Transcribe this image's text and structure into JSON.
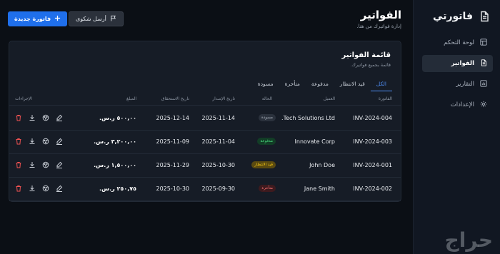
{
  "app": {
    "name": "فاتورتي"
  },
  "sidebar": {
    "items": [
      {
        "label": "لوحة التحكم",
        "icon": "layout-icon",
        "active": false
      },
      {
        "label": "الفواتير",
        "icon": "file-icon",
        "active": true
      },
      {
        "label": "التقارير",
        "icon": "chart-icon",
        "active": false
      },
      {
        "label": "الإعدادات",
        "icon": "gear-icon",
        "active": false
      }
    ]
  },
  "header": {
    "title": "الفواتير",
    "subtitle": "إدارة فواتيرك من هنا.",
    "feedback_label": "أرسل شكوى",
    "new_invoice_label": "فاتورة جديدة"
  },
  "card": {
    "title": "قائمة الفواتير",
    "subtitle": "قائمة بجميع فواتيرك."
  },
  "tabs": [
    {
      "label": "الكل",
      "active": true
    },
    {
      "label": "قيد الانتظار",
      "active": false
    },
    {
      "label": "مدفوعة",
      "active": false
    },
    {
      "label": "متأخرة",
      "active": false
    },
    {
      "label": "مسودة",
      "active": false
    }
  ],
  "table": {
    "headers": {
      "invoice": "الفاتورة",
      "client": "العميل",
      "status": "الحالة",
      "issue_date": "تاريخ الإصدار",
      "due_date": "تاريخ الاستحقاق",
      "amount": "المبلغ",
      "actions": "الإجراءات"
    },
    "rows": [
      {
        "invoice": "INV-2024-004",
        "client": "Tech Solutions Ltd.",
        "status": "مسودة",
        "issue_date": "2025-11-14",
        "due_date": "2025-12-14",
        "amount": "٥٠٠,٠٠ ر.س."
      },
      {
        "invoice": "INV-2024-003",
        "client": "Innovate Corp",
        "status": "مدفوعة",
        "issue_date": "2025-11-04",
        "due_date": "2025-11-09",
        "amount": "٣,٢٠٠,٠٠ ر.س."
      },
      {
        "invoice": "INV-2024-001",
        "client": "John Doe",
        "status": "قيد الانتظار",
        "issue_date": "2025-10-30",
        "due_date": "2025-11-29",
        "amount": "١,٥٠٠,٠٠ ر.س."
      },
      {
        "invoice": "INV-2024-002",
        "client": "Jane Smith",
        "status": "متأخرة",
        "issue_date": "2025-09-30",
        "due_date": "2025-10-30",
        "amount": "٢٥٠,٧٥ ر.س."
      }
    ]
  },
  "status_colors": {
    "مسودة": {
      "bg": "#2a313c",
      "fg": "#aab2bd"
    },
    "مدفوعة": {
      "bg": "#123d26",
      "fg": "#4ade80"
    },
    "قيد الانتظار": {
      "bg": "#5a4a10",
      "fg": "#facc15"
    },
    "متأخرة": {
      "bg": "#3d1a1e",
      "fg": "#f87171"
    }
  },
  "accent_color": "#1f6feb",
  "watermark": "حراج"
}
